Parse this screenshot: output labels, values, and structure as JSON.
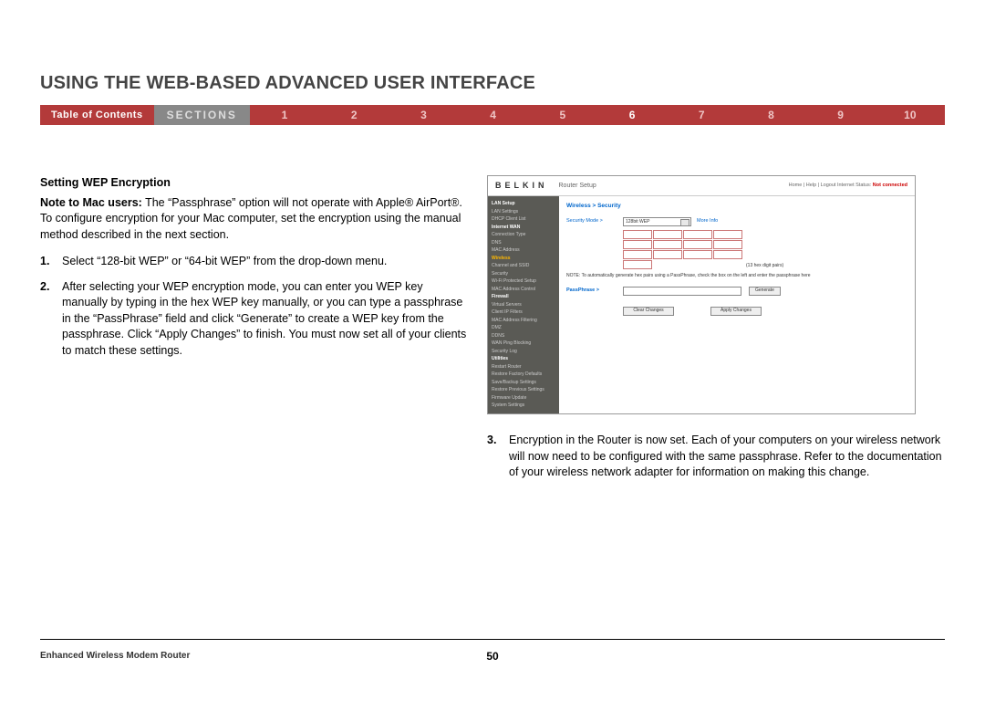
{
  "header": {
    "title": "USING THE WEB-BASED ADVANCED USER INTERFACE"
  },
  "nav": {
    "toc": "Table of Contents",
    "sections_label": "SECTIONS",
    "items": [
      "1",
      "2",
      "3",
      "4",
      "5",
      "6",
      "7",
      "8",
      "9",
      "10"
    ],
    "active_index": 5
  },
  "left": {
    "subheading": "Setting WEP Encryption",
    "note_label": "Note to Mac users:",
    "note_body": " The “Passphrase” option will not operate with Apple® AirPort®. To configure encryption for your Mac computer, set the encryption using the manual method described in the next section.",
    "steps": [
      {
        "num": "1.",
        "text": "Select “128-bit WEP” or “64-bit WEP” from the drop-down menu."
      },
      {
        "num": "2.",
        "text": "After selecting your WEP encryption mode, you can enter you WEP key manually by typing in the hex WEP key manually, or you can type a passphrase in the “PassPhrase” field and click “Generate” to create a WEP key from the passphrase. Click “Apply Changes” to finish. You must now set all of your clients to match these settings."
      }
    ]
  },
  "screenshot": {
    "brand": "BELKIN",
    "router_setup": "Router Setup",
    "header_links": "Home | Help | Logout  Internet Status:",
    "header_status": "Not connected",
    "breadcrumb": "Wireless > Security",
    "security_mode_label": "Security Mode >",
    "security_mode_value": "128bit WEP",
    "more_info": "More Info",
    "hex_note": "(13 hex digit pairs)",
    "note_text": "NOTE: To automatically generate hex pairs using a PassPhrase, check the box on the left and enter the passphrase here",
    "passphrase_label": "PassPhrase >",
    "generate_btn": "Generate",
    "clear_btn": "Clear Changes",
    "apply_btn": "Apply Changes",
    "sidebar": {
      "groups": [
        {
          "head": "LAN Setup",
          "items": [
            "LAN Settings",
            "DHCP Client List"
          ]
        },
        {
          "head": "Internet WAN",
          "items": [
            "Connection Type",
            "DNS",
            "MAC Address"
          ]
        },
        {
          "head": "Wireless",
          "active": true,
          "items": [
            "Channel and SSID",
            "Security",
            "Wi-Fi Protected Setup",
            "MAC Address Control"
          ]
        },
        {
          "head": "Firewall",
          "items": [
            "Virtual Servers",
            "Client IP Filters",
            "MAC Address Filtering",
            "DMZ",
            "DDNS",
            "WAN Ping Blocking",
            "Security Log"
          ]
        },
        {
          "head": "Utilities",
          "items": [
            "Restart Router",
            "Restore Factory Defaults",
            "Save/Backup Settings",
            "Restore Previous Settings",
            "Firmware Update",
            "System Settings"
          ]
        }
      ]
    }
  },
  "right": {
    "step3_num": "3.",
    "step3_text": "Encryption in the Router is now set. Each of your computers on your wireless network will now need to be configured with the same passphrase. Refer to the documentation of your wireless network adapter for information on making this change."
  },
  "footer": {
    "product": "Enhanced Wireless Modem Router",
    "page": "50"
  }
}
